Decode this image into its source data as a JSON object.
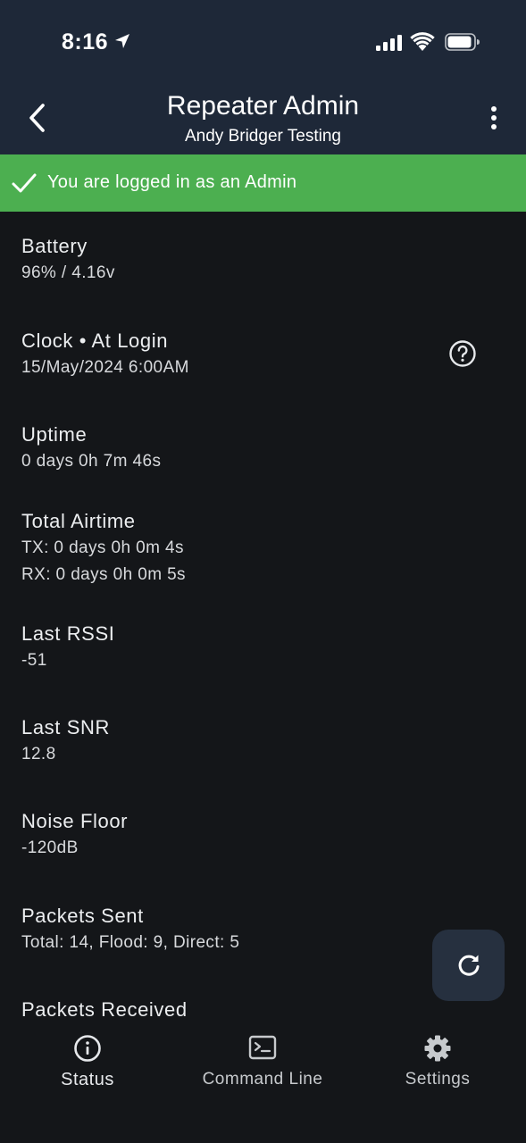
{
  "statusbar": {
    "time": "8:16"
  },
  "header": {
    "title": "Repeater Admin",
    "subtitle": "Andy Bridger Testing"
  },
  "banner": {
    "text": "You are logged in as an Admin",
    "color": "#4caf50"
  },
  "items": [
    {
      "label": "Battery",
      "values": [
        "96% / 4.16v"
      ]
    },
    {
      "label": "Clock • At Login",
      "values": [
        "15/May/2024 6:00AM"
      ]
    },
    {
      "label": "Uptime",
      "values": [
        "0 days 0h 7m 46s"
      ]
    },
    {
      "label": "Total Airtime",
      "values": [
        "TX: 0 days 0h 0m 4s",
        "RX: 0 days 0h 0m 5s"
      ]
    },
    {
      "label": "Last RSSI",
      "values": [
        "-51"
      ]
    },
    {
      "label": "Last SNR",
      "values": [
        "12.8"
      ]
    },
    {
      "label": "Noise Floor",
      "values": [
        "-120dB"
      ]
    },
    {
      "label": "Packets Sent",
      "values": [
        "Total: 14, Flood: 9, Direct: 5"
      ]
    },
    {
      "label": "Packets Received",
      "values": []
    }
  ],
  "icons": {
    "back": "chevron-left-icon",
    "more": "more-vertical-icon",
    "help": "help-circle-icon",
    "refresh": "refresh-icon",
    "check": "check-icon"
  },
  "nav": {
    "items": [
      {
        "label": "Status",
        "icon": "info-icon",
        "active": true
      },
      {
        "label": "Command Line",
        "icon": "terminal-icon",
        "active": false
      },
      {
        "label": "Settings",
        "icon": "gear-icon",
        "active": false
      }
    ]
  },
  "colors": {
    "header_bg": "#1e2838",
    "body_bg": "#141619",
    "fab_bg": "#26303f"
  }
}
